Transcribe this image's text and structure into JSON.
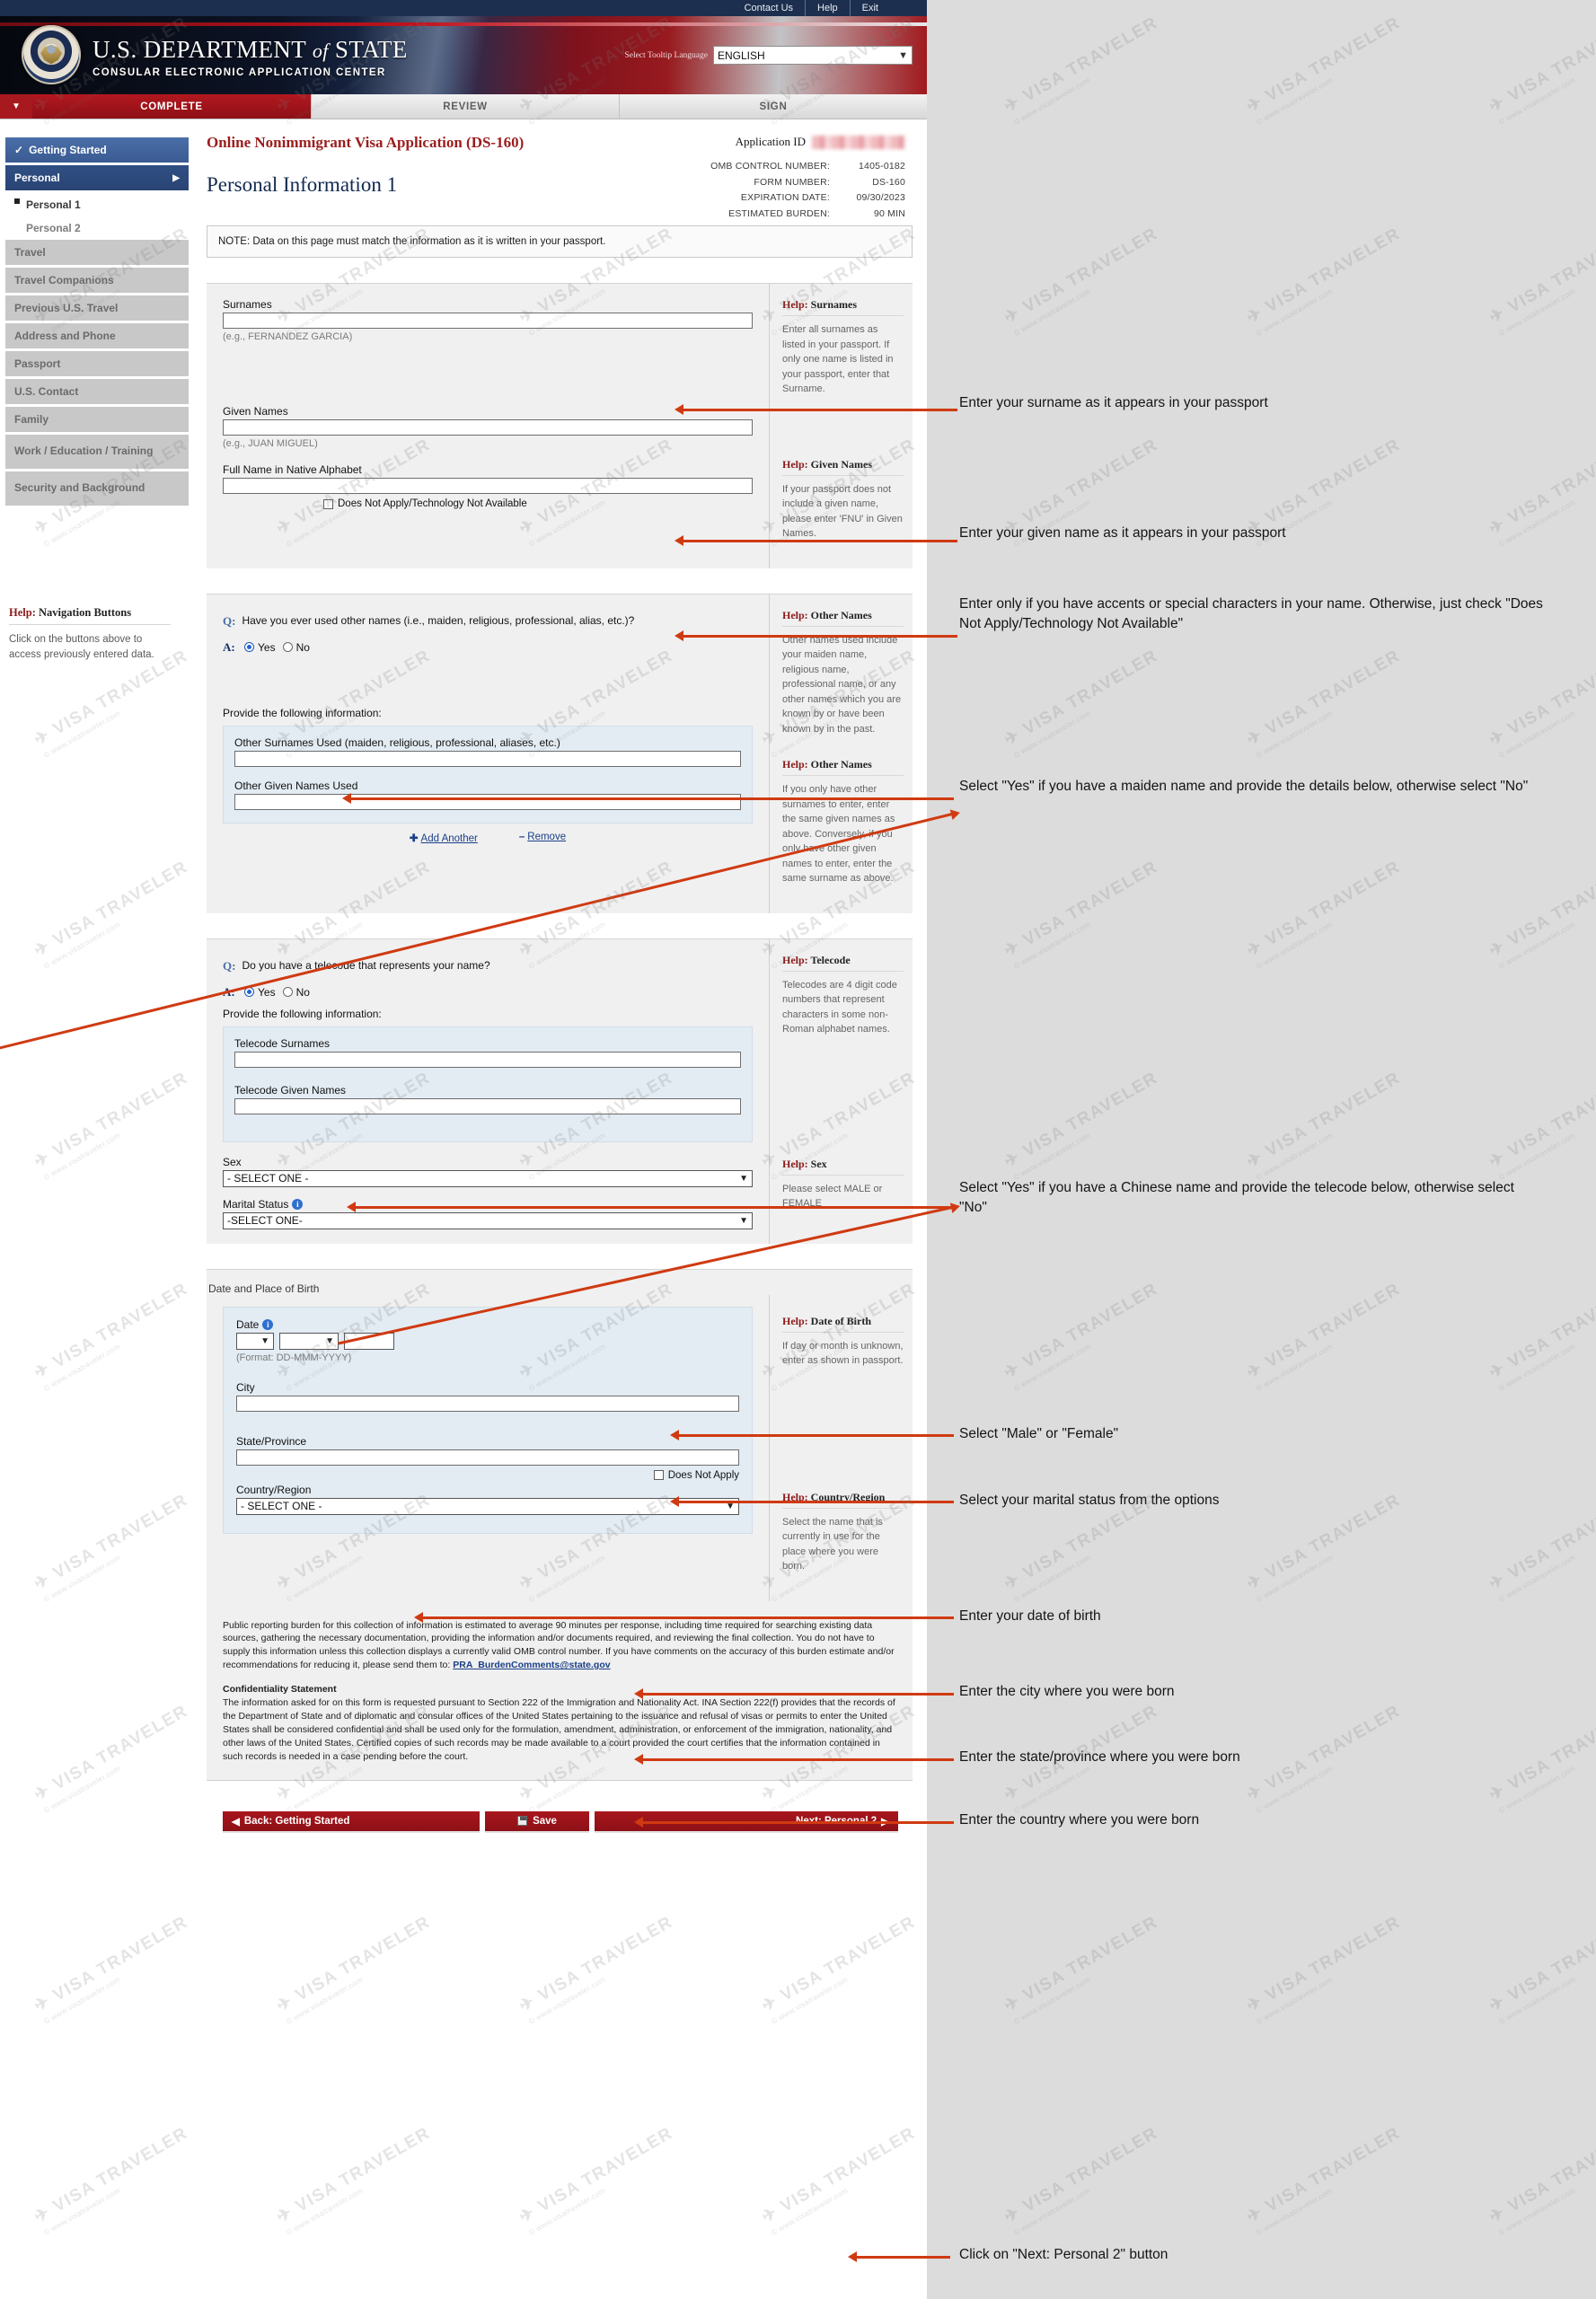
{
  "topbar": {
    "links": [
      "Contact Us",
      "Help",
      "Exit"
    ]
  },
  "masthead": {
    "title_main": "U.S. DEPARTMENT",
    "title_of": "of",
    "title_state": "STATE",
    "subtitle": "CONSULAR ELECTRONIC APPLICATION CENTER",
    "tooltip_label": "Select Tooltip Language",
    "language_value": "ENGLISH"
  },
  "tabs": [
    {
      "label": "COMPLETE",
      "state": "active"
    },
    {
      "label": "REVIEW",
      "state": "inactive"
    },
    {
      "label": "SIGN",
      "state": "inactive"
    }
  ],
  "sidebar": {
    "items": [
      {
        "label": "Getting Started",
        "style": "active-blue",
        "icon": "check-icon"
      },
      {
        "label": "Personal",
        "style": "active-darkblue",
        "icon": "chevron-right-icon"
      },
      {
        "label": "Personal 1",
        "style": "sub-current"
      },
      {
        "label": "Personal 2",
        "style": "sub"
      },
      {
        "label": "Travel",
        "style": "grey"
      },
      {
        "label": "Travel Companions",
        "style": "grey"
      },
      {
        "label": "Previous U.S. Travel",
        "style": "grey"
      },
      {
        "label": "Address and Phone",
        "style": "grey"
      },
      {
        "label": "Passport",
        "style": "grey"
      },
      {
        "label": "U.S. Contact",
        "style": "grey"
      },
      {
        "label": "Family",
        "style": "grey"
      },
      {
        "label": "Work / Education / Training",
        "style": "grey"
      },
      {
        "label": "Security and Background",
        "style": "grey"
      }
    ],
    "help": {
      "title_strong": "Help:",
      "title_rest": " Navigation Buttons",
      "text": "Click on the buttons above to access previously entered data."
    }
  },
  "header": {
    "app_title": "Online Nonimmigrant Visa Application (DS-160)",
    "application_id_label": "Application ID",
    "application_id_value": "",
    "page_title": "Personal Information 1",
    "meta": [
      {
        "key": "OMB CONTROL NUMBER:",
        "value": "1405-0182"
      },
      {
        "key": "FORM NUMBER:",
        "value": "DS-160"
      },
      {
        "key": "EXPIRATION DATE:",
        "value": "09/30/2023"
      },
      {
        "key": "ESTIMATED BURDEN:",
        "value": "90 MIN"
      }
    ]
  },
  "note": "NOTE: Data on this page must match the information as it is written in your passport.",
  "form": {
    "surnames": {
      "label": "Surnames",
      "value": "",
      "hint": "(e.g., FERNANDEZ GARCIA)",
      "help_title_strong": "Help:",
      "help_title_rest": " Surnames",
      "help_text": "Enter all surnames as listed in your passport. If only one name is listed in your passport, enter that Surname."
    },
    "given_names": {
      "label": "Given Names",
      "value": "",
      "hint": "(e.g., JUAN MIGUEL)",
      "help_title_strong": "Help:",
      "help_title_rest": " Given Names",
      "help_text": "If your passport does not include a given name, please enter 'FNU' in Given Names."
    },
    "native_alphabet": {
      "label": "Full Name in Native Alphabet",
      "value": "",
      "checkbox_label": "Does Not Apply/Technology Not Available",
      "checked": false
    },
    "other_names": {
      "question": "Have you ever used other names (i.e., maiden, religious, professional, alias, etc.)?",
      "q_marker": "Q:",
      "a_marker": "A:",
      "yes_label": "Yes",
      "no_label": "No",
      "selected": "Yes",
      "provide_label": "Provide the following information:",
      "surnames_label": "Other Surnames Used (maiden, religious, professional, aliases, etc.)",
      "surnames_value": "",
      "given_label": "Other Given Names Used",
      "given_value": "",
      "add_label": "Add Another",
      "remove_label": "Remove",
      "help1_title_strong": "Help:",
      "help1_title_rest": " Other Names",
      "help1_text": "Other names used include your maiden name, religious name, professional name, or any other names which you are known by or have been known by in the past.",
      "help2_title_strong": "Help:",
      "help2_title_rest": " Other Names",
      "help2_text": "If you only have other surnames to enter, enter the same given names as above. Conversely, if you only have other given names to enter, enter the same surname as above."
    },
    "telecode": {
      "question": "Do you have a telecode that represents your name?",
      "q_marker": "Q:",
      "a_marker": "A:",
      "yes_label": "Yes",
      "no_label": "No",
      "selected": "Yes",
      "provide_label": "Provide the following information:",
      "surnames_label": "Telecode Surnames",
      "surnames_value": "",
      "given_label": "Telecode Given Names",
      "given_value": "",
      "help_title_strong": "Help:",
      "help_title_rest": " Telecode",
      "help_text": "Telecodes are 4 digit code numbers that represent characters in some non-Roman alphabet names."
    },
    "sex": {
      "label": "Sex",
      "value": "- SELECT ONE -",
      "help_title_strong": "Help:",
      "help_title_rest": " Sex",
      "help_text": "Please select MALE or FEMALE"
    },
    "marital_status": {
      "label": "Marital Status",
      "value": "-SELECT ONE-",
      "info_icon": "info-icon"
    },
    "birth": {
      "section_label": "Date and Place of Birth",
      "date_label": "Date",
      "day_value": "",
      "month_value": "",
      "year_value": "",
      "format_hint": "(Format: DD-MMM-YYYY)",
      "city_label": "City",
      "city_value": "",
      "state_label": "State/Province",
      "state_value": "",
      "state_dna_label": "Does Not Apply",
      "state_dna_checked": false,
      "country_label": "Country/Region",
      "country_value": "- SELECT ONE -",
      "help_dob_title_strong": "Help:",
      "help_dob_title_rest": " Date of Birth",
      "help_dob_text": "If day or month is unknown, enter as shown in passport.",
      "help_country_title_strong": "Help:",
      "help_country_title_rest": " Country/Region",
      "help_country_text": "Select the name that is currently in use for the place where you were born."
    }
  },
  "legal": {
    "burden": "Public reporting burden for this collection of information is estimated to average 90 minutes per response, including time required for searching existing data sources, gathering the necessary documentation, providing the information and/or documents required, and reviewing the final collection. You do not have to supply this information unless this collection displays a currently valid OMB control number. If you have comments on the accuracy of this burden estimate and/or recommendations for reducing it, please send them to:",
    "email": "PRA_BurdenComments@state.gov",
    "confidentiality_heading": "Confidentiality Statement",
    "confidentiality": "The information asked for on this form is requested pursuant to Section 222 of the Immigration and Nationality Act. INA Section 222(f) provides that the records of the Department of State and of diplomatic and consular offices of the United States pertaining to the issuance and refusal of visas or permits to enter the United States shall be considered confidential and shall be used only for the formulation, amendment, administration, or enforcement of the immigration, nationality, and other laws of the United States. Certified copies of such records may be made available to a court provided the court certifies that the information contained in such records is needed in a case pending before the court."
  },
  "footer": {
    "back_label": "Back: Getting Started",
    "save_label": "Save",
    "next_label": "Next: Personal 2",
    "save_icon": "floppy-disk-icon"
  },
  "annotations": [
    {
      "id": "surname",
      "text": "Enter your surname as it appears in your passport"
    },
    {
      "id": "given",
      "text": "Enter your given name as it appears in your passport"
    },
    {
      "id": "native",
      "text": "Enter only if you have accents or special characters in your name. Otherwise, just check \"Does Not Apply/Technology Not Available\""
    },
    {
      "id": "other",
      "text": "Select \"Yes\" if you have a maiden name and provide the details below, otherwise select \"No\""
    },
    {
      "id": "telecode",
      "text": "Select \"Yes\" if you have a Chinese name and provide the telecode below, otherwise select \"No\""
    },
    {
      "id": "sex",
      "text": "Select \"Male\" or \"Female\""
    },
    {
      "id": "marital",
      "text": "Select your marital status from the options"
    },
    {
      "id": "dob",
      "text": "Enter your date of birth"
    },
    {
      "id": "city",
      "text": "Enter the city where you were born"
    },
    {
      "id": "state",
      "text": "Enter the state/province where you were born"
    },
    {
      "id": "country",
      "text": "Enter the country where you were born"
    },
    {
      "id": "next",
      "text": "Click on \"Next: Personal 2\" button"
    }
  ],
  "watermark": {
    "text": "VISA TRAVELER",
    "sub": "© www.visatraveler.com"
  },
  "colors": {
    "brand_red": "#a8161d",
    "accent_blue": "#2f4f84",
    "arrow": "#d03a12",
    "help_red": "#8b1a1a"
  }
}
